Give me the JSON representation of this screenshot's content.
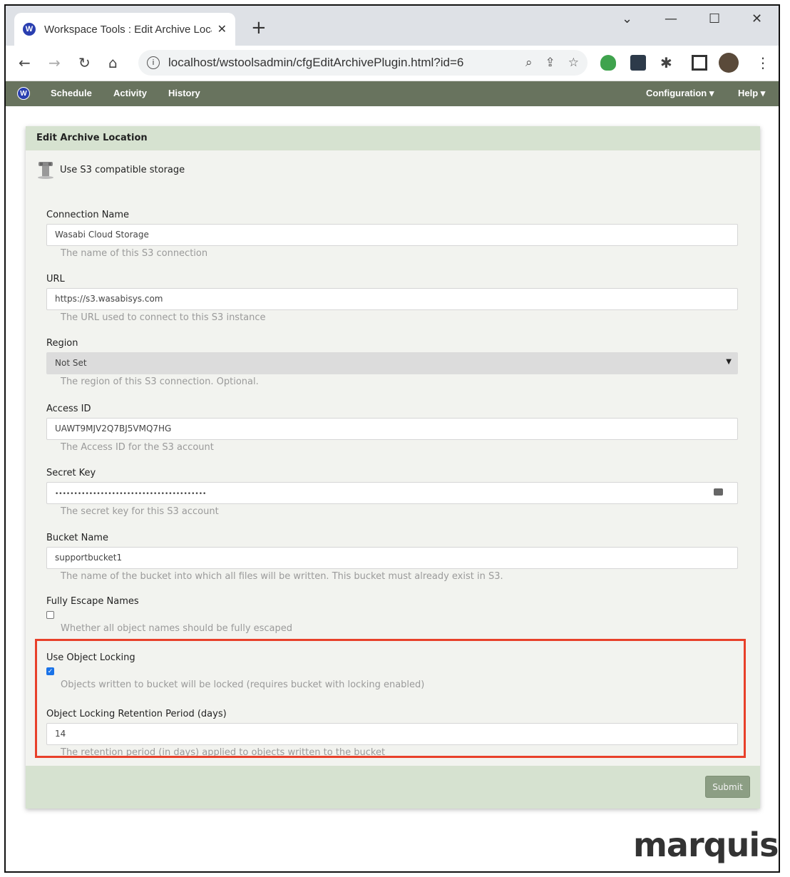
{
  "browser": {
    "tab_title": "Workspace Tools : Edit Archive Location",
    "url": "localhost/wstoolsadmin/cfgEditArchivePlugin.html?id=6",
    "favicon_letter": "W"
  },
  "nav": {
    "logo_letter": "W",
    "items": [
      "Schedule",
      "Activity",
      "History"
    ],
    "right": [
      "Configuration ▾",
      "Help ▾"
    ]
  },
  "panel": {
    "title": "Edit Archive Location",
    "storage_type": "Use S3 compatible storage",
    "fields": [
      {
        "label": "Connection Name",
        "value": "Wasabi Cloud Storage",
        "help": "The name of this S3 connection"
      },
      {
        "label": "URL",
        "value": "https://s3.wasabisys.com",
        "help": "The URL used to connect to this S3 instance"
      },
      {
        "label": "Region",
        "value": "Not Set",
        "help": "The region of this S3 connection. Optional."
      },
      {
        "label": "Access ID",
        "value": "UAWT9MJV2Q7BJ5VMQ7HG",
        "help": "The Access ID for the S3 account"
      },
      {
        "label": "Secret Key",
        "value": "••••••••••••••••••••••••••••••••••••••••",
        "help": "The secret key for this S3 account"
      },
      {
        "label": "Bucket Name",
        "value": "supportbucket1",
        "help": "The name of the bucket into which all files will be written. This bucket must already exist in S3."
      },
      {
        "label": "Fully Escape Names",
        "checked": false,
        "help": "Whether all object names should be fully escaped"
      },
      {
        "label": "Use Object Locking",
        "checked": true,
        "help": "Objects written to bucket will be locked (requires bucket with locking enabled)"
      },
      {
        "label": "Object Locking Retention Period (days)",
        "value": "14",
        "help": "The retention period (in days) applied to objects written to the bucket"
      }
    ],
    "submit_label": "Submit"
  },
  "brand": "marquis",
  "colors": {
    "nav": "#68735e",
    "panel_header": "#d6e2d0",
    "highlight_box": "#e8402a",
    "submit": "#8c9e84"
  }
}
